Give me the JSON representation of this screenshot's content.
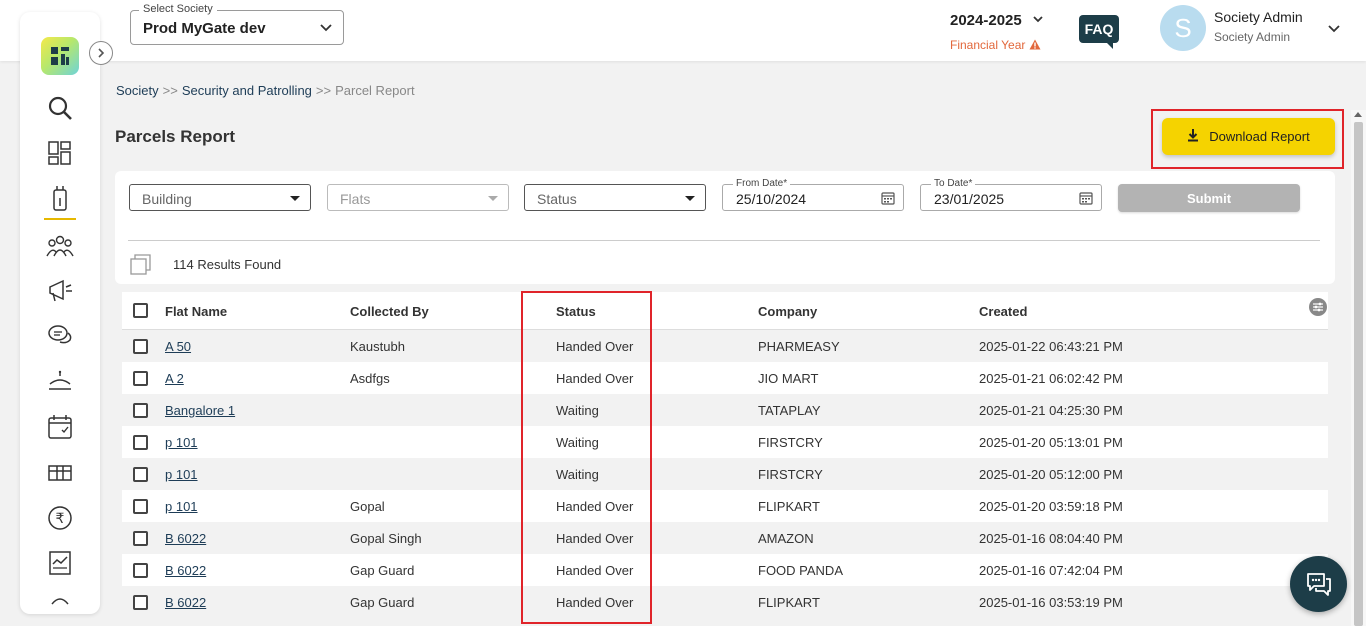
{
  "header": {
    "society_label": "Select Society",
    "society_value": "Prod MyGate dev",
    "financial_year": "2024-2025",
    "financial_year_label": "Financial Year",
    "faq_label": "FAQ",
    "avatar_initial": "S",
    "user_name": "Society Admin",
    "user_role": "Society Admin"
  },
  "sidebar": {
    "items": [
      "search-icon",
      "dashboard-icon",
      "security-icon",
      "residents-icon",
      "announcement-icon",
      "chat-icon",
      "amenities-icon",
      "calendar-icon",
      "parcel-box-icon",
      "rupee-icon",
      "reports-icon",
      "more-icon"
    ]
  },
  "breadcrumb": {
    "items": [
      "Society",
      "Security and Patrolling",
      "Parcel Report"
    ],
    "separator": ">>"
  },
  "page": {
    "title": "Parcels Report",
    "download_label": "Download Report"
  },
  "filters": {
    "building_placeholder": "Building",
    "flats_placeholder": "Flats",
    "status_placeholder": "Status",
    "from_date_label": "From Date*",
    "from_date_value": "25/10/2024",
    "to_date_label": "To Date*",
    "to_date_value": "23/01/2025",
    "submit_label": "Submit"
  },
  "results": {
    "count_text": "114 Results Found"
  },
  "table": {
    "columns": [
      "Flat Name",
      "Collected By",
      "Status",
      "Company",
      "Created"
    ],
    "rows": [
      {
        "flat": "A 50",
        "collected_by": "Kaustubh",
        "status": "Handed Over",
        "company": "PHARMEASY",
        "created": "2025-01-22 06:43:21 PM"
      },
      {
        "flat": "A 2",
        "collected_by": "Asdfgs",
        "status": "Handed Over",
        "company": "JIO MART",
        "created": "2025-01-21 06:02:42 PM"
      },
      {
        "flat": "Bangalore 1",
        "collected_by": "",
        "status": "Waiting",
        "company": "TATAPLAY",
        "created": "2025-01-21 04:25:30 PM"
      },
      {
        "flat": "p 101",
        "collected_by": "",
        "status": "Waiting",
        "company": "FIRSTCRY",
        "created": "2025-01-20 05:13:01 PM"
      },
      {
        "flat": "p 101",
        "collected_by": "",
        "status": "Waiting",
        "company": "FIRSTCRY",
        "created": "2025-01-20 05:12:00 PM"
      },
      {
        "flat": "p 101",
        "collected_by": "Gopal",
        "status": "Handed Over",
        "company": "FLIPKART",
        "created": "2025-01-20 03:59:18 PM"
      },
      {
        "flat": "B 6022",
        "collected_by": "Gopal Singh",
        "status": "Handed Over",
        "company": "AMAZON",
        "created": "2025-01-16 08:04:40 PM"
      },
      {
        "flat": "B 6022",
        "collected_by": "Gap Guard",
        "status": "Handed Over",
        "company": "FOOD PANDA",
        "created": "2025-01-16 07:42:04 PM"
      },
      {
        "flat": "B 6022",
        "collected_by": "Gap Guard",
        "status": "Handed Over",
        "company": "FLIPKART",
        "created": "2025-01-16 03:53:19 PM"
      }
    ]
  },
  "colors": {
    "accent_yellow": "#f5d300",
    "highlight_red": "#e0242a",
    "dark_teal": "#1d3d48",
    "warning_orange": "#e2683c"
  }
}
